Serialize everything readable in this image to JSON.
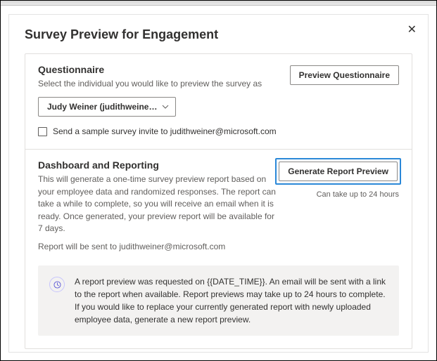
{
  "modal": {
    "title": "Survey Preview for Engagement"
  },
  "questionnaire": {
    "title": "Questionnaire",
    "desc": "Select the individual you would like to preview the survey as",
    "preview_btn": "Preview Questionnaire",
    "dropdown_value": "Judy Weiner (judithweiner…",
    "checkbox_label": "Send a sample survey invite to judithweiner@microsoft.com"
  },
  "dashboard": {
    "title": "Dashboard and Reporting",
    "desc": "This will generate a one-time survey preview report based on your employee data and randomized responses. The report can take a while to complete, so you will receive an email when it is ready. Once generated, your preview report will be available for 7 days.",
    "sent_to": "Report will be sent to judithweiner@microsoft.com",
    "generate_btn": "Generate Report Preview",
    "hint": "Can take up to 24 hours",
    "info": "A report preview was requested on {{DATE_TIME}}. An email will be sent with a link to the report when available. Report previews may take up to 24 hours to complete. If you would like to replace your currently generated report with newly uploaded employee data, generate a new report preview."
  }
}
